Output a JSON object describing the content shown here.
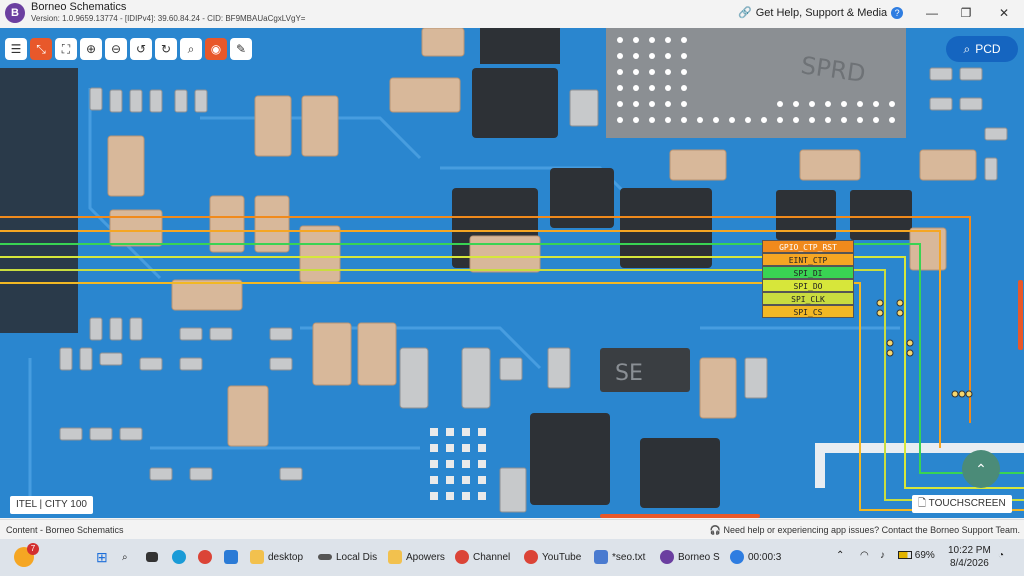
{
  "window": {
    "title": "Borneo Schematics",
    "version": "Version: 1.0.9659.13774 - [IDIPv4]: 39.60.84.24 - CID: BF9MBAUaCgxLVgY=",
    "help_link": "Get Help, Support & Media",
    "minimize": "—",
    "maximize": "❐",
    "close": "✕"
  },
  "toolbar": {
    "buttons": [
      {
        "name": "list-icon",
        "glyph": "☰"
      },
      {
        "name": "collapse-icon",
        "glyph": "⤡",
        "active": true
      },
      {
        "name": "fit-screen-icon",
        "glyph": "⛶"
      },
      {
        "name": "zoom-in-icon",
        "glyph": "⊕"
      },
      {
        "name": "zoom-out-icon",
        "glyph": "⊖"
      },
      {
        "name": "rotate-left-icon",
        "glyph": "↺"
      },
      {
        "name": "rotate-right-icon",
        "glyph": "↻"
      },
      {
        "name": "search-icon",
        "glyph": "⌕"
      },
      {
        "name": "mouse-icon",
        "glyph": "◉",
        "active": true
      },
      {
        "name": "edit-icon",
        "glyph": "✎"
      }
    ]
  },
  "pcd_button": {
    "icon": "search-icon",
    "label": "PCD"
  },
  "net_labels": [
    {
      "label": "GPIO_CTP_RST",
      "color": "#f08a1c"
    },
    {
      "label": "EINT_CTP",
      "color": "#f5a623"
    },
    {
      "label": "SPI_DI",
      "color": "#39d353"
    },
    {
      "label": "SPI_DO",
      "color": "#d7e63a"
    },
    {
      "label": "SPI_CLK",
      "color": "#c9dc3f"
    },
    {
      "label": "SPI_CS",
      "color": "#f2b824"
    }
  ],
  "board": {
    "model": "ITEL | CITY 100",
    "component_mark": "SE",
    "chip_mark": "SPRD",
    "touch_tag": "TOUCHSCREEN",
    "scroll_top_icon": "chevron-up-icon"
  },
  "status": {
    "left": "Content - Borneo Schematics",
    "right": "Need help or experiencing app issues? Contact the Borneo Support Team."
  },
  "taskbar": {
    "weather_badge": "7",
    "apps": [
      {
        "label": "desktop",
        "color": "#f2c14e"
      },
      {
        "label": "Local Dis",
        "color": "#555"
      },
      {
        "label": "Apowers",
        "color": "#f2c14e"
      },
      {
        "label": "Channel",
        "color": "#db4437"
      },
      {
        "label": "YouTube",
        "color": "#db4437"
      },
      {
        "label": "*seo.txt",
        "color": "#4a7bd0"
      },
      {
        "label": "Borneo S",
        "color": "#6b3fa0"
      },
      {
        "label": "00:00:3",
        "color": "#2e7de1"
      }
    ],
    "battery": "69%",
    "time": "10:22 PM",
    "date": "8/4/2026"
  }
}
